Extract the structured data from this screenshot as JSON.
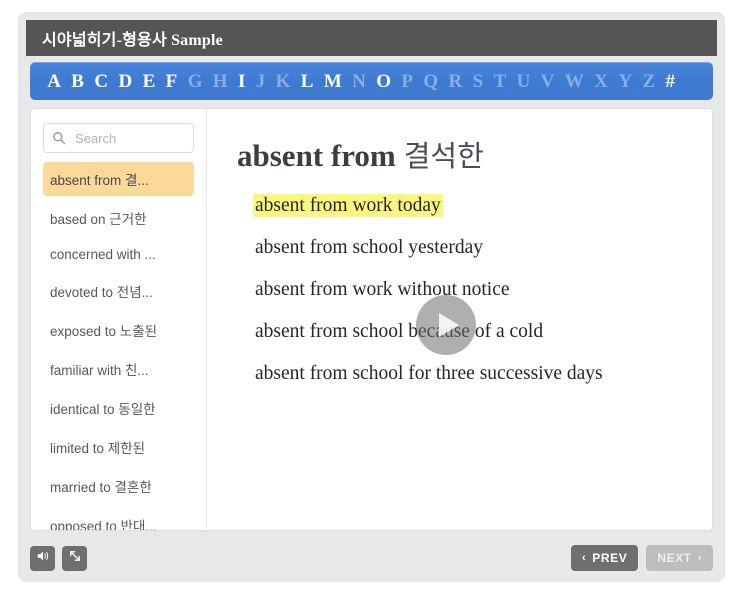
{
  "window": {
    "title": "시야넓히기-형용사 Sample"
  },
  "alphabet_nav": {
    "letters": [
      {
        "label": "A",
        "active": true
      },
      {
        "label": "B",
        "active": true
      },
      {
        "label": "C",
        "active": true
      },
      {
        "label": "D",
        "active": true
      },
      {
        "label": "E",
        "active": true
      },
      {
        "label": "F",
        "active": true
      },
      {
        "label": "G",
        "active": false
      },
      {
        "label": "H",
        "active": false
      },
      {
        "label": "I",
        "active": true
      },
      {
        "label": "J",
        "active": false
      },
      {
        "label": "K",
        "active": false
      },
      {
        "label": "L",
        "active": true
      },
      {
        "label": "M",
        "active": true
      },
      {
        "label": "N",
        "active": false
      },
      {
        "label": "O",
        "active": true
      },
      {
        "label": "P",
        "active": false
      },
      {
        "label": "Q",
        "active": false
      },
      {
        "label": "R",
        "active": false
      },
      {
        "label": "S",
        "active": false
      },
      {
        "label": "T",
        "active": false
      },
      {
        "label": "U",
        "active": false
      },
      {
        "label": "V",
        "active": false
      },
      {
        "label": "W",
        "active": false
      },
      {
        "label": "X",
        "active": false
      },
      {
        "label": "Y",
        "active": false
      },
      {
        "label": "Z",
        "active": false
      },
      {
        "label": "#",
        "active": true
      }
    ],
    "bar_color": "#4079cf",
    "active_color": "#ffffff",
    "inactive_color": "#89aee4"
  },
  "sidebar": {
    "search": {
      "placeholder": "Search",
      "value": "",
      "icon": "search-icon"
    },
    "items": [
      {
        "label": "absent from 결...",
        "selected": true
      },
      {
        "label": "based on 근거한",
        "selected": false
      },
      {
        "label": "concerned with ...",
        "selected": false
      },
      {
        "label": "devoted to 전념...",
        "selected": false
      },
      {
        "label": "exposed to 노출된",
        "selected": false
      },
      {
        "label": "familiar with 친...",
        "selected": false
      },
      {
        "label": "identical to 동일한",
        "selected": false
      },
      {
        "label": "limited to 제한된",
        "selected": false
      },
      {
        "label": "married to 결혼한",
        "selected": false
      },
      {
        "label": "opposed to 반대...",
        "selected": false
      }
    ],
    "selected_color": "#fcd89a"
  },
  "detail": {
    "headword_en": "absent from",
    "headword_ko": "결석한",
    "sentences": [
      {
        "text": "absent from work today",
        "highlighted": true
      },
      {
        "text": "absent from school yesterday",
        "highlighted": false
      },
      {
        "text": "absent from work without notice",
        "highlighted": false
      },
      {
        "text": "absent from school because of a cold",
        "highlighted": false
      },
      {
        "text": "absent from school for three successive days",
        "highlighted": false
      }
    ],
    "highlight_color": "#fbf67f",
    "play_button": "play-icon"
  },
  "toolbar": {
    "volume_icon": "volume-icon",
    "resize_icon": "resize-icon",
    "prev_label": "PREV",
    "next_label": "NEXT",
    "prev_chevron": "‹",
    "next_chevron": "›"
  }
}
